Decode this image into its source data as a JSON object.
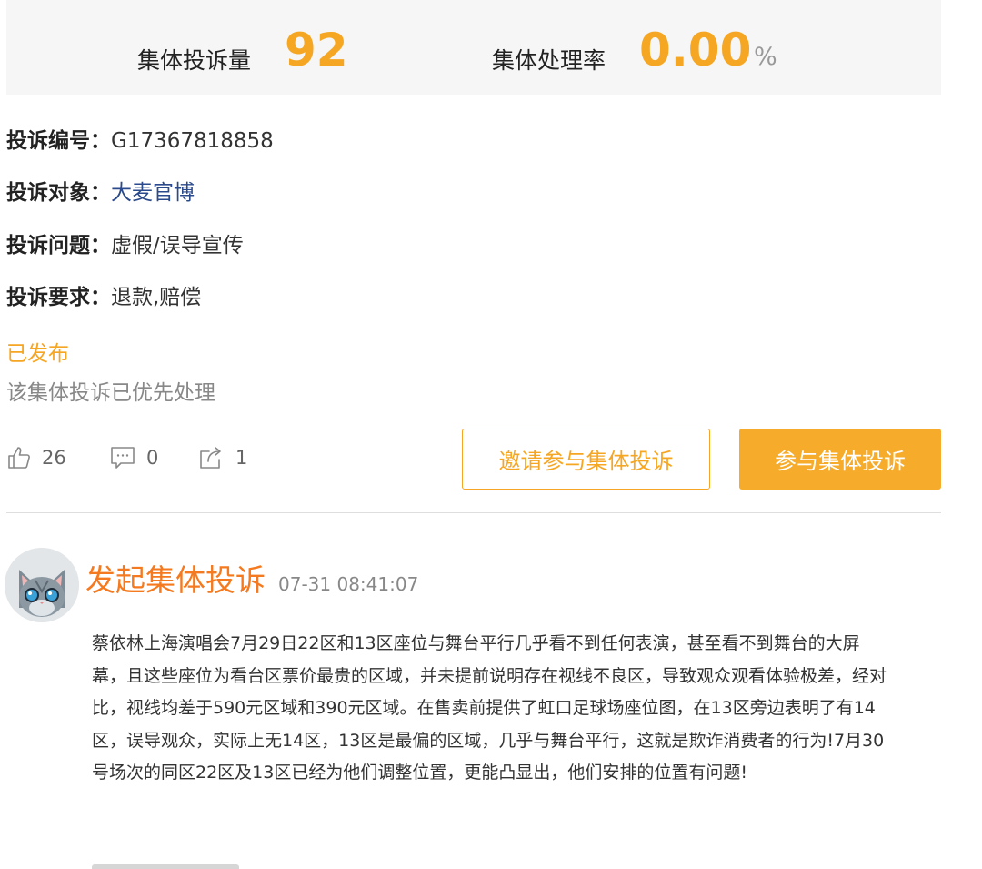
{
  "stats": {
    "count_label": "集体投诉量",
    "count_value": "92",
    "rate_label": "集体处理率",
    "rate_value": "0.00",
    "rate_unit": "%"
  },
  "fields": [
    {
      "key": "投诉编号：",
      "value": "G17367818858"
    },
    {
      "key": "投诉对象：",
      "value": "大麦官博"
    },
    {
      "key": "投诉问题：",
      "value": "虚假/误导宣传"
    },
    {
      "key": "投诉要求：",
      "value": "退款,赔偿"
    }
  ],
  "status": {
    "label": "已发布",
    "note": "该集体投诉已优先处理"
  },
  "actions": {
    "likes": "26",
    "comments": "0",
    "shares": "1",
    "invite_label": "邀请参与集体投诉",
    "join_label": "参与集体投诉"
  },
  "post": {
    "title": "发起集体投诉",
    "time": "07-31 08:41:07",
    "body": "蔡依林上海演唱会7月29日22区和13区座位与舞台平行几乎看不到任何表演，甚至看不到舞台的大屏幕，且这些座位为看台区票价最贵的区域，并未提前说明存在视线不良区，导致观众观看体验极差，经对比，视线均差于590元区域和390元区域。在售卖前提供了虹口足球场座位图，在13区旁边表明了有14区，误导观众，实际上无14区，13区是最偏的区域，几乎与舞台平行，这就是欺诈消费者的行为!7月30号场次的同区22区及13区已经为他们调整位置，更能凸显出，他们安排的位置有问题!"
  },
  "colors": {
    "accent": "#f5a623",
    "title_orange": "#f57a1f",
    "link_blue": "#2b4a8b"
  },
  "icons": [
    "thumbs-up-icon",
    "comment-icon",
    "share-icon",
    "cat-avatar"
  ]
}
